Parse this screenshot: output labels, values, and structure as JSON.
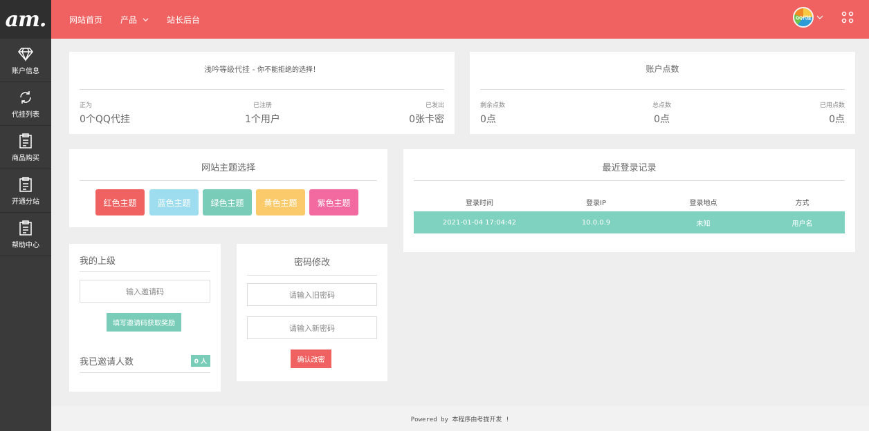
{
  "sidebar": {
    "logo": "am.",
    "items": [
      {
        "label": "账户信息",
        "icon": "diamond-icon"
      },
      {
        "label": "代挂列表",
        "icon": "refresh-icon"
      },
      {
        "label": "商品购买",
        "icon": "clipboard-icon"
      },
      {
        "label": "开通分站",
        "icon": "clipboard-icon"
      },
      {
        "label": "帮助中心",
        "icon": "clipboard-icon"
      }
    ]
  },
  "header": {
    "nav": [
      {
        "label": "网站首页"
      },
      {
        "label": "产品"
      },
      {
        "label": "站长后台"
      }
    ],
    "avatar_text": "QQ代挂",
    "color": "#f06262"
  },
  "intro_card": {
    "title_a": "浅吟等级代挂 - ",
    "title_b": "你不能拒绝的选择！",
    "stats": [
      {
        "label": "正为",
        "value": "0个QQ代挂"
      },
      {
        "label": "已注册",
        "value": "1个用户"
      },
      {
        "label": "已发出",
        "value": "0张卡密"
      }
    ]
  },
  "points_card": {
    "title": "账户点数",
    "stats": [
      {
        "label": "剩余点数",
        "value": "0点"
      },
      {
        "label": "总点数",
        "value": "0点"
      },
      {
        "label": "已用点数",
        "value": "0点"
      }
    ]
  },
  "theme_card": {
    "title": "网站主题选择",
    "buttons": [
      {
        "label": "红色主题",
        "color": "#f06262"
      },
      {
        "label": "蓝色主题",
        "color": "#9edcef"
      },
      {
        "label": "绿色主题",
        "color": "#79cdb8"
      },
      {
        "label": "黄色主题",
        "color": "#fbcb6b"
      },
      {
        "label": "紫色主题",
        "color": "#f36aa0"
      }
    ]
  },
  "login_card": {
    "title": "最近登录记录",
    "headers": [
      "登录时间",
      "登录IP",
      "登录地点",
      "方式"
    ],
    "rows": [
      [
        "2021-01-04 17:04:42",
        "10.0.0.9",
        "未知",
        "用户名"
      ]
    ]
  },
  "superior_card": {
    "title": "我的上级",
    "invite_placeholder": "输入邀请码",
    "submit_label": "填写邀请码获取奖励",
    "invited_label": "我已邀请人数",
    "invited_count": "0 人"
  },
  "password_card": {
    "title": "密码修改",
    "old_placeholder": "请输入旧密码",
    "new_placeholder": "请输入新密码",
    "confirm_label": "确认改密"
  },
  "footer": {
    "text": "Powered by 本程序由考拢开发 !"
  }
}
